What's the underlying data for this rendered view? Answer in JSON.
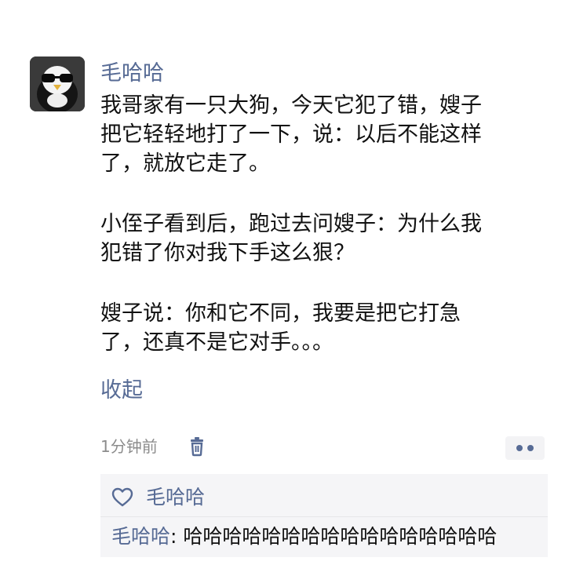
{
  "post": {
    "author": "毛哈哈",
    "lines": [
      "我哥家有一只大狗，今天它犯了错，嫂子",
      "把它轻轻地打了一下，说：以后不能这样",
      "了，就放它走了。",
      "小侄子看到后，跑过去问嫂子：为什么我",
      "犯错了你对我下手这么狠？",
      "嫂子说：你和它不同，我要是把它打急",
      "了，还真不是它对手。。。"
    ],
    "collapse_label": "收起",
    "timestamp": "1分钟前"
  },
  "icons": {
    "avatar": "penguin-sunglasses-avatar",
    "delete": "trash-icon",
    "more": "more-dots-icon",
    "like": "heart-icon"
  },
  "likes": {
    "names": "毛哈哈"
  },
  "comments": [
    {
      "author": "毛哈哈",
      "separator": ": ",
      "text": "哈哈哈哈哈哈哈哈哈哈哈哈哈哈哈哈"
    }
  ],
  "colors": {
    "link": "#576b95",
    "text": "#111111",
    "muted": "#8c8c8c",
    "panel": "#f5f5f7"
  }
}
